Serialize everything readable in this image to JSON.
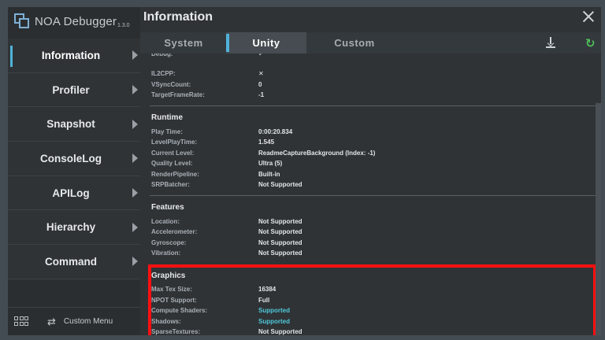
{
  "app": {
    "name": "NOA Debugger",
    "version": "1.3.0"
  },
  "sidebar": {
    "items": [
      {
        "label": "Information"
      },
      {
        "label": "Profiler"
      },
      {
        "label": "Snapshot"
      },
      {
        "label": "ConsoleLog"
      },
      {
        "label": "APILog"
      },
      {
        "label": "Hierarchy"
      },
      {
        "label": "Command"
      }
    ],
    "bottom": {
      "swap_icon": "⇄",
      "custom_menu": "Custom Menu"
    }
  },
  "main": {
    "title": "Information",
    "tabs": [
      {
        "label": "System"
      },
      {
        "label": "Unity"
      },
      {
        "label": "Custom"
      }
    ],
    "refresh_icon": "↻"
  },
  "content": {
    "top_rows": [
      {
        "key": "Debug:",
        "value": "✓"
      },
      {
        "key": "IL2CPP:",
        "value": "✕"
      },
      {
        "key": "VSyncCount:",
        "value": "0"
      },
      {
        "key": "TargetFrameRate:",
        "value": "-1"
      }
    ],
    "runtime": {
      "title": "Runtime",
      "rows": [
        {
          "key": "Play Time:",
          "value": "0:00:20.834"
        },
        {
          "key": "LevelPlayTime:",
          "value": "1.545"
        },
        {
          "key": "Current Level:",
          "value": "ReadmeCaptureBackground (Index: -1)"
        },
        {
          "key": "Quality Level:",
          "value": "Ultra (5)"
        },
        {
          "key": "RenderPipeline:",
          "value": "Built-in"
        },
        {
          "key": "SRPBatcher:",
          "value": "Not Supported"
        }
      ]
    },
    "features": {
      "title": "Features",
      "rows": [
        {
          "key": "Location:",
          "value": "Not Supported"
        },
        {
          "key": "Accelerometer:",
          "value": "Not Supported"
        },
        {
          "key": "Gyroscope:",
          "value": "Not Supported"
        },
        {
          "key": "Vibration:",
          "value": "Not Supported"
        }
      ]
    },
    "graphics": {
      "title": "Graphics",
      "rows": [
        {
          "key": "Max Tex Size:",
          "value": "16384"
        },
        {
          "key": "NPOT Support:",
          "value": "Full"
        },
        {
          "key": "Compute Shaders:",
          "value": "Supported"
        },
        {
          "key": "Shadows:",
          "value": "Supported"
        },
        {
          "key": "SparseTextures:",
          "value": "Not Supported"
        }
      ]
    }
  },
  "colors": {
    "accent": "#4fb3d9",
    "supported": "#4fc8d9",
    "refresh": "#4fc05a",
    "highlight": "#ff1010"
  }
}
